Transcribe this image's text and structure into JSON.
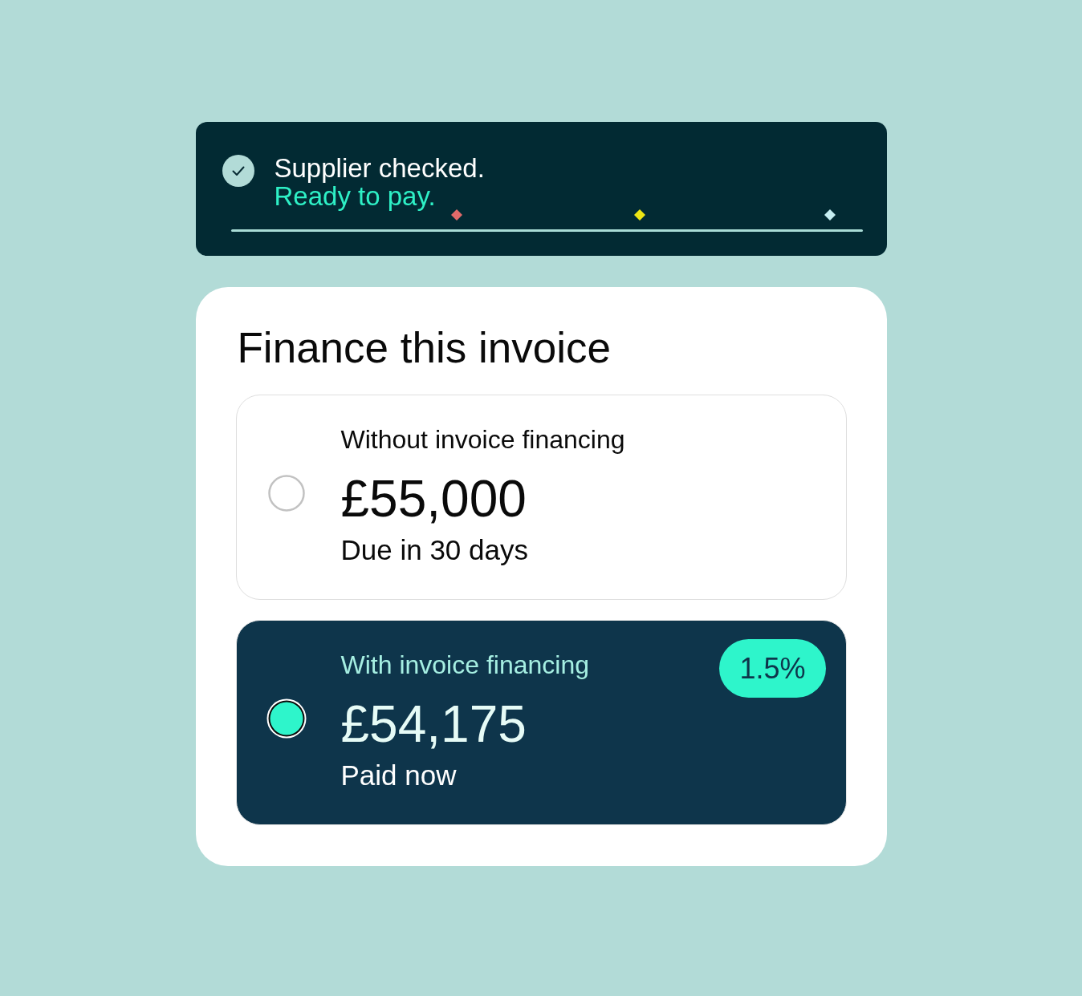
{
  "toast": {
    "title": "Supplier checked.",
    "message": "Ready to pay.",
    "confetti": [
      {
        "color": "#e06a6a"
      },
      {
        "color": "#ece514"
      },
      {
        "color": "#c6eef2"
      }
    ]
  },
  "card": {
    "title": "Finance this invoice",
    "options": [
      {
        "label": "Without invoice financing",
        "amount": "£55,000",
        "note": "Due in 30 days",
        "selected": false
      },
      {
        "label": "With invoice financing",
        "amount": "£54,175",
        "note": "Paid now",
        "badge": "1.5%",
        "selected": true
      }
    ]
  }
}
